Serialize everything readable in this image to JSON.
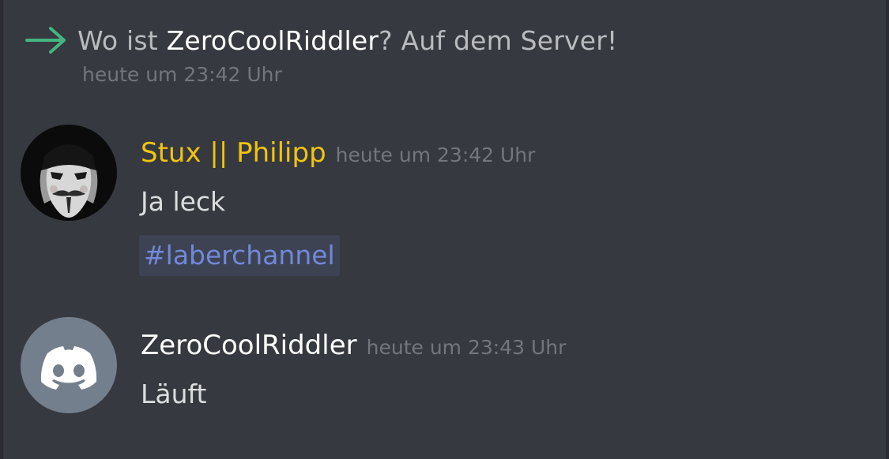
{
  "system_message": {
    "prefix": "Wo ist ",
    "username": "ZeroCoolRiddler",
    "suffix": "? Auf dem Server!",
    "timestamp": "heute um 23:42 Uhr",
    "icon": "arrow-right-icon",
    "icon_color": "#43b581"
  },
  "messages": [
    {
      "author": "Stux || Philipp",
      "author_color": "#f1c40f",
      "timestamp": "heute um 23:42 Uhr",
      "text": "Ja leck",
      "channel_mention": "#laberchannel",
      "avatar": "guy-fawkes-mask-avatar"
    },
    {
      "author": "ZeroCoolRiddler",
      "author_color": "#ffffff",
      "timestamp": "heute um 23:43 Uhr",
      "text": "Läuft",
      "avatar": "discord-default-avatar"
    }
  ],
  "colors": {
    "background": "#36393f",
    "muted_text": "#72767d",
    "body_text": "#dcddde",
    "mention": "#7289da",
    "default_avatar_bg": "#747f8d"
  }
}
